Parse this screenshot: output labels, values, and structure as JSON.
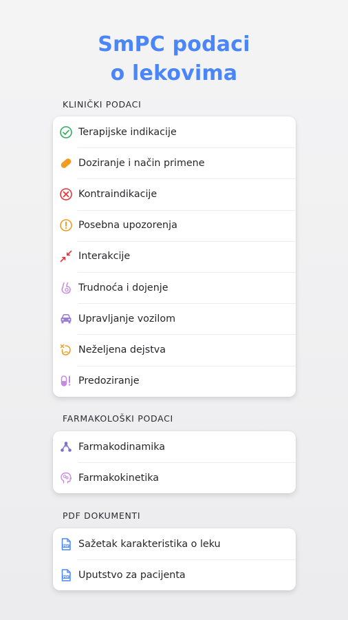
{
  "header": {
    "title_line1": "SmPC podaci",
    "title_line2": "o lekovima"
  },
  "sections": [
    {
      "label": "KLINIČKI PODACI",
      "items": [
        {
          "label": "Terapijske indikacije",
          "icon": "check-circle-icon",
          "color": "#2fae5a"
        },
        {
          "label": "Doziranje i način primene",
          "icon": "pill-icon",
          "color": "#f39a1f"
        },
        {
          "label": "Kontraindikacije",
          "icon": "prohibited-x-icon",
          "color": "#e5333a"
        },
        {
          "label": "Posebna upozorenja",
          "icon": "warning-exclamation-icon",
          "color": "#f39a1f"
        },
        {
          "label": "Interakcije",
          "icon": "interaction-arrows-icon",
          "color": "#e5333a"
        },
        {
          "label": "Trudnoća i dojenje",
          "icon": "pregnancy-icon",
          "color": "#c58be0"
        },
        {
          "label": "Upravljanje vozilom",
          "icon": "car-icon",
          "color": "#9a7fd6"
        },
        {
          "label": "Neželjena dejstva",
          "icon": "side-effect-icon",
          "color": "#f39a1f"
        },
        {
          "label": "Predoziranje",
          "icon": "overdose-pill-icon",
          "color": "#c58be0"
        }
      ]
    },
    {
      "label": "FARMAKOLOŠKI PODACI",
      "items": [
        {
          "label": "Farmakodinamika",
          "icon": "molecule-icon",
          "color": "#7d6fd0"
        },
        {
          "label": "Farmakokinetika",
          "icon": "brain-head-icon",
          "color": "#c58be0"
        }
      ]
    },
    {
      "label": "PDF DOKUMENTI",
      "items": [
        {
          "label": "Sažetak karakteristika o leku",
          "icon": "pdf-document-icon",
          "color": "#4a86f7"
        },
        {
          "label": "Uputstvo za pacijenta",
          "icon": "pdf-document-icon",
          "color": "#4a86f7"
        }
      ]
    }
  ],
  "colors": {
    "accent": "#4a86f7",
    "text": "#26262a"
  }
}
